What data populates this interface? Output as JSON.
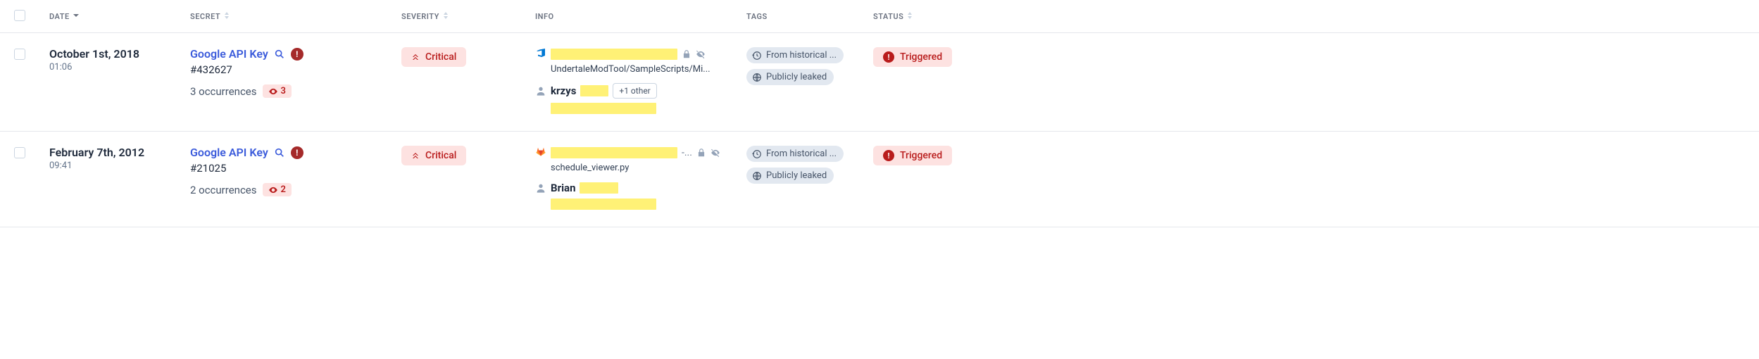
{
  "headers": {
    "date": "DATE",
    "secret": "SECRET",
    "severity": "SEVERITY",
    "info": "INFO",
    "tags": "TAGS",
    "status": "STATUS"
  },
  "rows": [
    {
      "date": "October 1st, 2018",
      "time": "01:06",
      "secret_name": "Google API Key",
      "secret_id": "#432627",
      "occurrences": "3 occurrences",
      "occurrences_count": "3",
      "severity": "Critical",
      "repo_provider": "azure",
      "path": "UndertaleModTool/SampleScripts/Mi...",
      "user": "krzys",
      "plus_other": "+1 other",
      "tags": [
        "From historical ...",
        "Publicly leaked"
      ],
      "status": "Triggered"
    },
    {
      "date": "February 7th, 2012",
      "time": "09:41",
      "secret_name": "Google API Key",
      "secret_id": "#21025",
      "occurrences": "2 occurrences",
      "occurrences_count": "2",
      "severity": "Critical",
      "repo_provider": "gitlab",
      "path": "schedule_viewer.py",
      "user": "Brian",
      "plus_other": "",
      "tags": [
        "From historical ...",
        "Publicly leaked"
      ],
      "status": "Triggered"
    }
  ]
}
